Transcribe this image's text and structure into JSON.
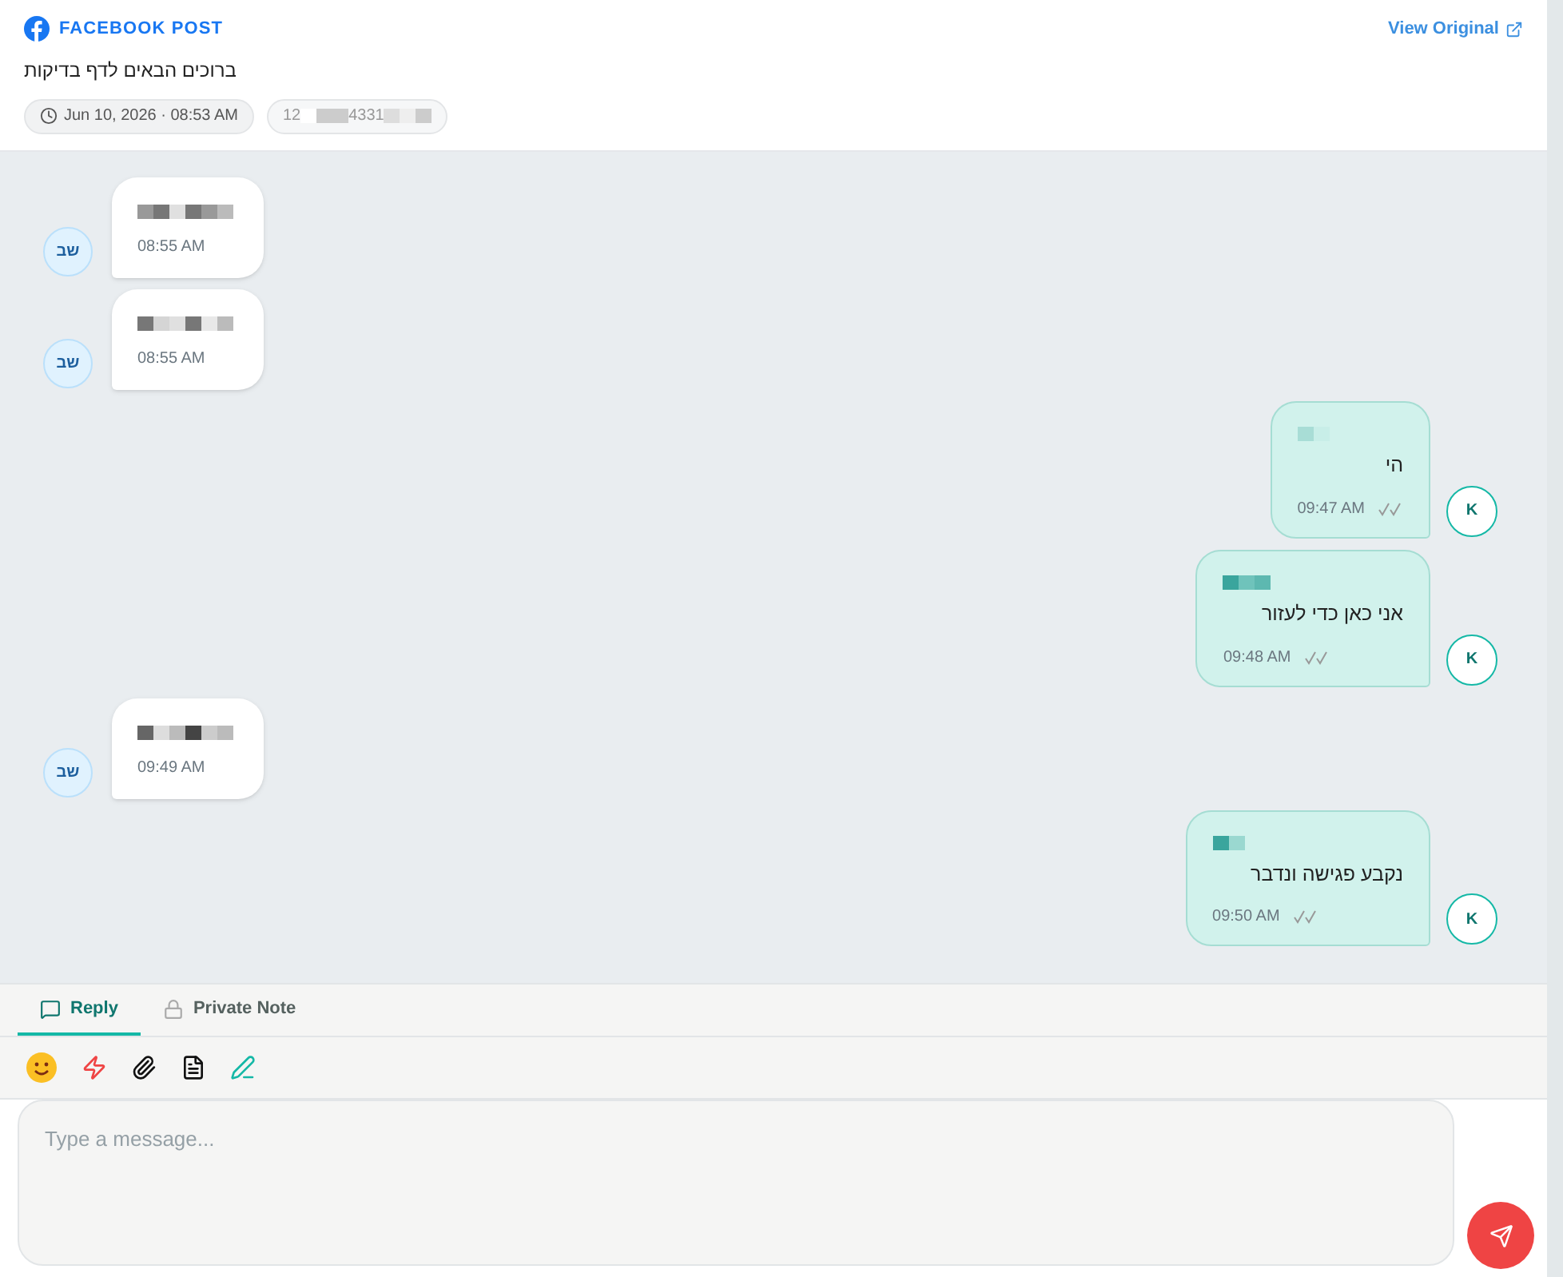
{
  "post": {
    "source": "FACEBOOK POST",
    "view_original": "View Original",
    "title": "ברוכים הבאים לדף בדיקות",
    "timestamp": "Jun 10, 2026 · 08:53 AM",
    "id_parts": [
      "12",
      "4331"
    ]
  },
  "messages": [
    {
      "kind": "incoming",
      "avatar": "שב",
      "time": "08:55 AM"
    },
    {
      "kind": "incoming",
      "avatar": "שב",
      "time": "08:55 AM"
    },
    {
      "kind": "outgoing",
      "avatar": "K",
      "text": "הי",
      "time": "09:47 AM"
    },
    {
      "kind": "outgoing",
      "avatar": "K",
      "text": "אני כאן כדי לעזור",
      "time": "09:48 AM"
    },
    {
      "kind": "incoming",
      "avatar": "שב",
      "time": "09:49 AM"
    },
    {
      "kind": "outgoing",
      "avatar": "K",
      "text": "נקבע פגישה ונדבר",
      "time": "09:50 AM"
    }
  ],
  "tabs": [
    {
      "label": "Reply",
      "kind": "reply",
      "selected": true
    },
    {
      "label": "Private Note",
      "kind": "note",
      "selected": false
    }
  ],
  "composer": {
    "placeholder": "Type a message..."
  }
}
